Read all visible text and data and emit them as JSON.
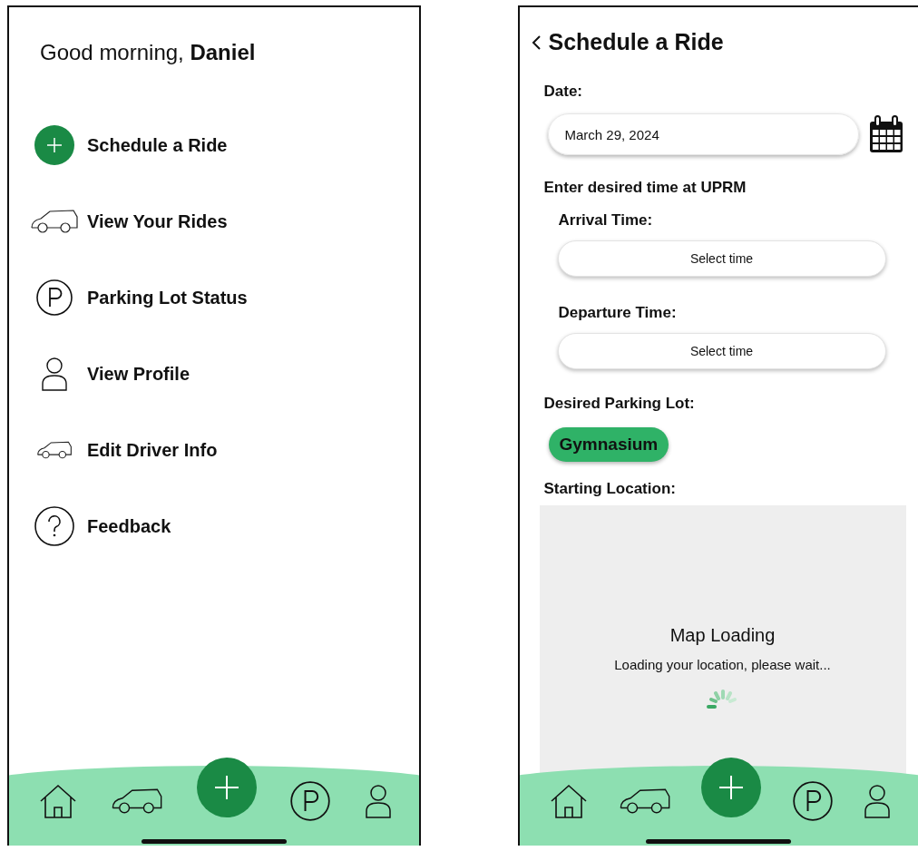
{
  "home_screen": {
    "greeting": "Good morning, **Daniel**",
    "menu": [
      {
        "kind": "plus",
        "label": "Schedule a Ride"
      },
      {
        "kind": "car",
        "label": "View Your Rides"
      },
      {
        "kind": "parking",
        "label": "Parking Lot Status"
      },
      {
        "kind": "person",
        "label": "View Profile"
      },
      {
        "kind": "car-small",
        "label": "Edit Driver Info"
      },
      {
        "kind": "question",
        "label": "Feedback"
      }
    ],
    "nav": [
      {
        "kind": "home"
      },
      {
        "kind": "car"
      },
      {
        "kind": "plus"
      },
      {
        "kind": "parking"
      },
      {
        "kind": "person"
      }
    ]
  },
  "schedule_screen": {
    "title": "Schedule a Ride",
    "date_label": "Date:",
    "date_value": "March 29, 2024",
    "time_heading": "Enter desired time at UPRM",
    "arrival_label": "Arrival Time:",
    "arrival_button": "Select time",
    "departure_label": "Departure Time:",
    "departure_button": "Select time",
    "parking_label": "Desired Parking Lot:",
    "parking_lots": [
      {
        "label": "Gymnasium",
        "selected": true
      }
    ],
    "location_label": "Starting Location:",
    "map": {
      "title": "Map Loading",
      "message": "Loading your location, please wait..."
    },
    "nav": [
      {
        "kind": "home"
      },
      {
        "kind": "car"
      },
      {
        "kind": "plus"
      },
      {
        "kind": "parking"
      },
      {
        "kind": "person"
      }
    ]
  }
}
